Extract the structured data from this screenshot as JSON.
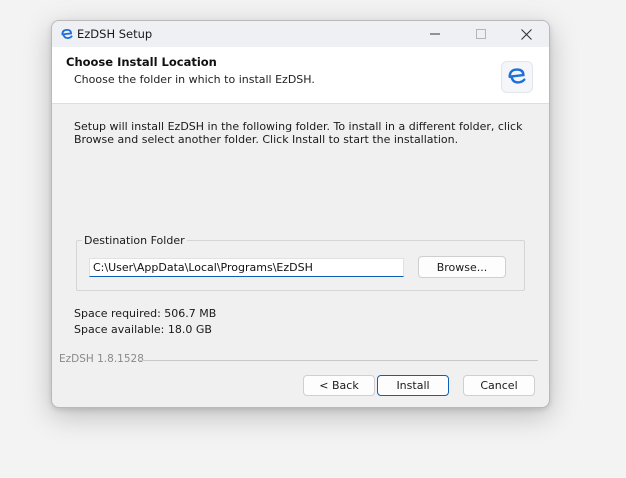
{
  "window": {
    "title": "EzDSH Setup",
    "icon": "ezdsh-logo-icon",
    "controls": {
      "minimize_icon": "minimize-icon",
      "maximize_icon": "maximize-icon",
      "close_icon": "close-icon"
    }
  },
  "header": {
    "title": "Choose Install Location",
    "subtitle": "Choose the folder in which to install EzDSH.",
    "icon": "ezdsh-logo-icon"
  },
  "body": {
    "description": "Setup will install EzDSH in the following folder. To install in a different folder, click Browse and select another folder. Click Install to start the installation.",
    "destination_label": "Destination Folder",
    "destination_path": "C:\\User\\AppData\\Local\\Programs\\EzDSH",
    "browse_label": "Browse...",
    "space_required": "Space required: 506.7 MB",
    "space_available": "Space available: 18.0 GB"
  },
  "footer": {
    "version": "EzDSH 1.8.1528",
    "back_label": "< Back",
    "install_label": "Install",
    "cancel_label": "Cancel"
  },
  "colors": {
    "accent": "#0f5fb8",
    "logo": "#1e6fd9"
  }
}
